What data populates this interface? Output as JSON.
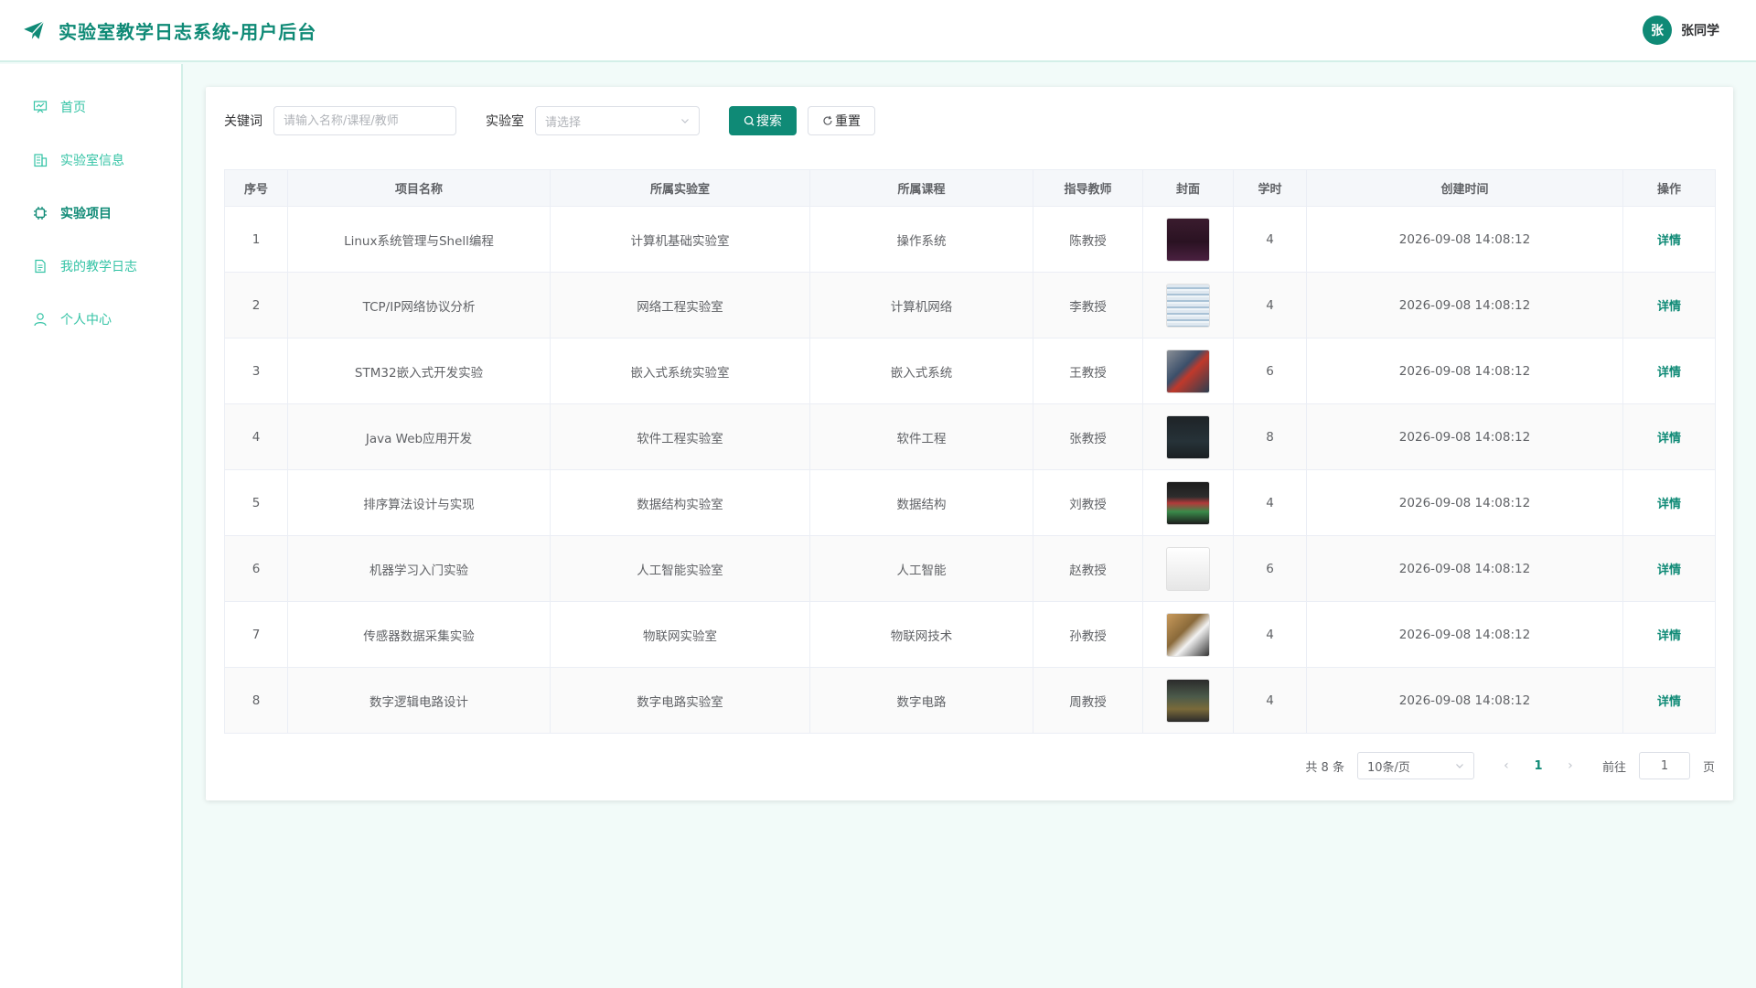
{
  "app": {
    "title": "实验室教学日志系统-用户后台",
    "brand_color": "#0f8a76",
    "brand_icon": "paper-plane-icon"
  },
  "user": {
    "avatar_text": "张",
    "name": "张同学"
  },
  "sidebar": {
    "items": [
      {
        "label": "首页",
        "icon": "dashboard-icon",
        "active": false
      },
      {
        "label": "实验室信息",
        "icon": "building-icon",
        "active": false
      },
      {
        "label": "实验项目",
        "icon": "chip-icon",
        "active": true
      },
      {
        "label": "我的教学日志",
        "icon": "document-icon",
        "active": false
      },
      {
        "label": "个人中心",
        "icon": "user-icon",
        "active": false
      }
    ]
  },
  "filters": {
    "keyword_label": "关键词",
    "keyword_placeholder": "请输入名称/课程/教师",
    "keyword_value": "",
    "lab_label": "实验室",
    "lab_placeholder": "请选择",
    "search_label": "搜索",
    "reset_label": "重置"
  },
  "table": {
    "columns": [
      "序号",
      "项目名称",
      "所属实验室",
      "所属课程",
      "指导教师",
      "封面",
      "学时",
      "创建时间",
      "操作"
    ],
    "rows": [
      {
        "no": "1",
        "name": "Linux系统管理与Shell编程",
        "lab": "计算机基础实验室",
        "course": "操作系统",
        "teacher": "陈教授",
        "cover": "terminal-screen-image",
        "hours": "4",
        "created": "2026-09-08 14:08:12",
        "action": "详情"
      },
      {
        "no": "2",
        "name": "TCP/IP网络协议分析",
        "lab": "网络工程实验室",
        "course": "计算机网络",
        "teacher": "李教授",
        "cover": "packet-capture-image",
        "hours": "4",
        "created": "2026-09-08 14:08:12",
        "action": "详情"
      },
      {
        "no": "3",
        "name": "STM32嵌入式开发实验",
        "lab": "嵌入式系统实验室",
        "course": "嵌入式系统",
        "teacher": "王教授",
        "cover": "dev-board-image",
        "hours": "6",
        "created": "2026-09-08 14:08:12",
        "action": "详情"
      },
      {
        "no": "4",
        "name": "Java Web应用开发",
        "lab": "软件工程实验室",
        "course": "软件工程",
        "teacher": "张教授",
        "cover": "code-editor-image",
        "hours": "8",
        "created": "2026-09-08 14:08:12",
        "action": "详情"
      },
      {
        "no": "5",
        "name": "排序算法设计与实现",
        "lab": "数据结构实验室",
        "course": "数据结构",
        "teacher": "刘教授",
        "cover": "sort-visual-image",
        "hours": "4",
        "created": "2026-09-08 14:08:12",
        "action": "详情"
      },
      {
        "no": "6",
        "name": "机器学习入门实验",
        "lab": "人工智能实验室",
        "course": "人工智能",
        "teacher": "赵教授",
        "cover": "ml-notebook-image",
        "hours": "6",
        "created": "2026-09-08 14:08:12",
        "action": "详情"
      },
      {
        "no": "7",
        "name": "传感器数据采集实验",
        "lab": "物联网实验室",
        "course": "物联网技术",
        "teacher": "孙教授",
        "cover": "sensor-kit-image",
        "hours": "4",
        "created": "2026-09-08 14:08:12",
        "action": "详情"
      },
      {
        "no": "8",
        "name": "数字逻辑电路设计",
        "lab": "数字电路实验室",
        "course": "数字电路",
        "teacher": "周教授",
        "cover": "circuit-board-image",
        "hours": "4",
        "created": "2026-09-08 14:08:12",
        "action": "详情"
      }
    ]
  },
  "pagination": {
    "total_text": "共 8 条",
    "page_size": "10条/页",
    "current_page": "1",
    "goto_label": "前往",
    "goto_value": "1",
    "page_suffix": "页"
  }
}
